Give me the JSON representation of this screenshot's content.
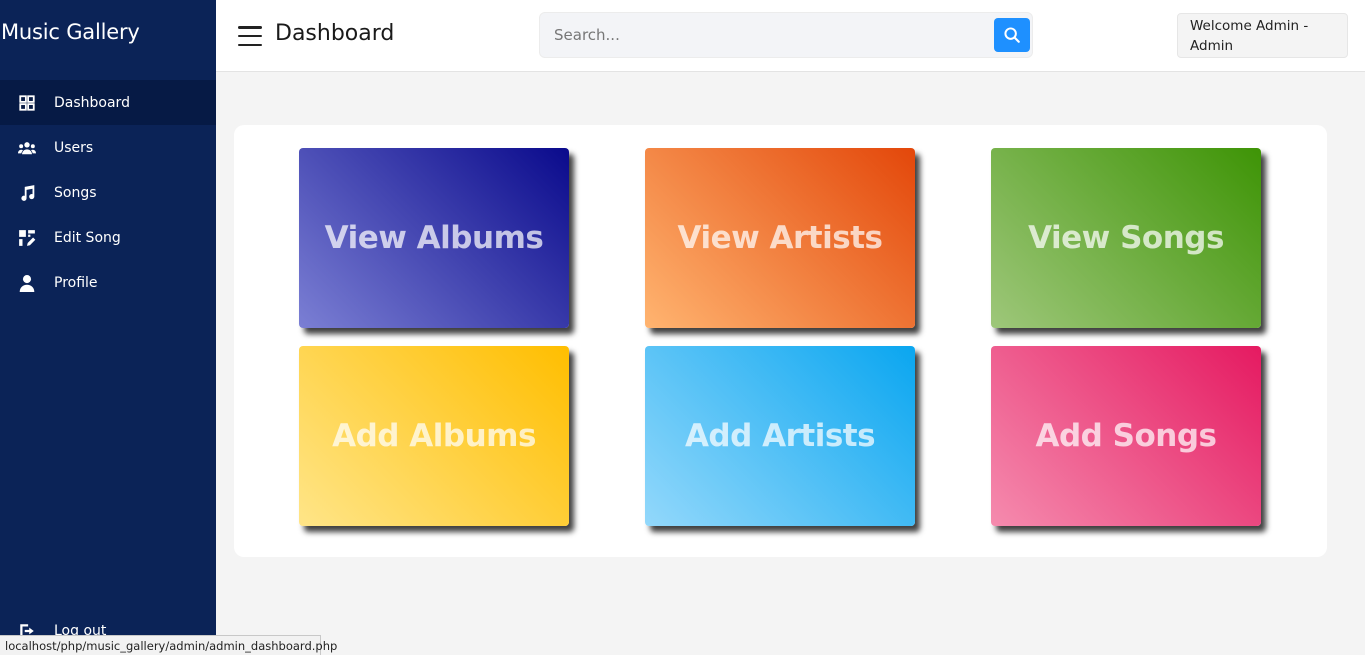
{
  "sidebar": {
    "brand": "Music Gallery",
    "items": [
      {
        "label": "Dashboard",
        "icon": "grid-icon",
        "active": true
      },
      {
        "label": "Users",
        "icon": "users-icon"
      },
      {
        "label": "Songs",
        "icon": "music-note-icon"
      },
      {
        "label": "Edit Song",
        "icon": "edit-song-icon"
      },
      {
        "label": "Profile",
        "icon": "user-icon"
      }
    ],
    "logout_label": "Log out"
  },
  "header": {
    "title": "Dashboard",
    "search_placeholder": "Search...",
    "welcome_text": "Welcome Admin - Admin"
  },
  "cards": [
    {
      "label": "View Albums",
      "gradient": [
        "#7b7fd4",
        "#0a0a8c"
      ]
    },
    {
      "label": "View Artists",
      "gradient": [
        "#ffb470",
        "#e3470a"
      ]
    },
    {
      "label": "View Songs",
      "gradient": [
        "#9ec77a",
        "#3e9406"
      ]
    },
    {
      "label": "Add Albums",
      "gradient": [
        "#ffe588",
        "#ffbe00"
      ]
    },
    {
      "label": "Add Artists",
      "gradient": [
        "#93d8fb",
        "#0aa6f0"
      ]
    },
    {
      "label": "Add Songs",
      "gradient": [
        "#f58bae",
        "#e51a61"
      ]
    }
  ],
  "statusbar": {
    "url": "localhost/php/music_gallery/admin/admin_dashboard.php"
  },
  "colors": {
    "sidebar_bg": "#0b2357",
    "sidebar_active": "#061a45",
    "accent": "#1e90ff"
  }
}
